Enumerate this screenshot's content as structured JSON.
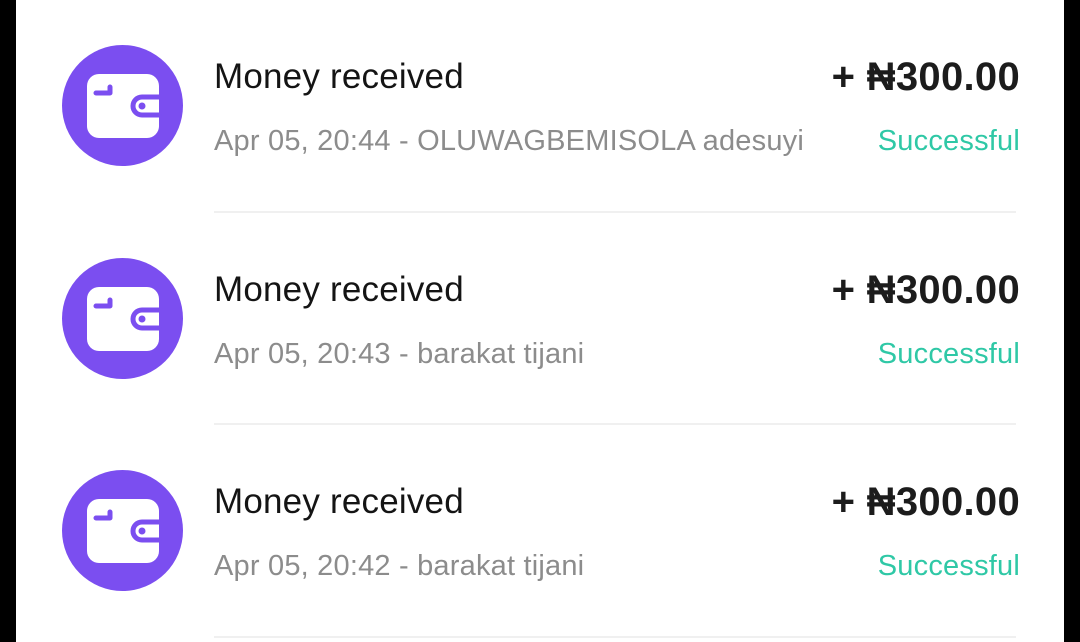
{
  "colors": {
    "accent": "#7b4ef0",
    "success": "#2fc8a6",
    "title_text": "#141414",
    "meta_text": "#8c8c8c"
  },
  "transactions": [
    {
      "icon": "wallet-icon",
      "title": "Money received",
      "amount": "+ ₦300.00",
      "meta": "Apr 05, 20:44 - OLUWAGBEMISOLA  adesuyi",
      "status": "Successful"
    },
    {
      "icon": "wallet-icon",
      "title": "Money received",
      "amount": "+ ₦300.00",
      "meta": "Apr 05, 20:43 - barakat  tijani",
      "status": "Successful"
    },
    {
      "icon": "wallet-icon",
      "title": "Money received",
      "amount": "+ ₦300.00",
      "meta": "Apr 05, 20:42 - barakat  tijani",
      "status": "Successful"
    }
  ]
}
